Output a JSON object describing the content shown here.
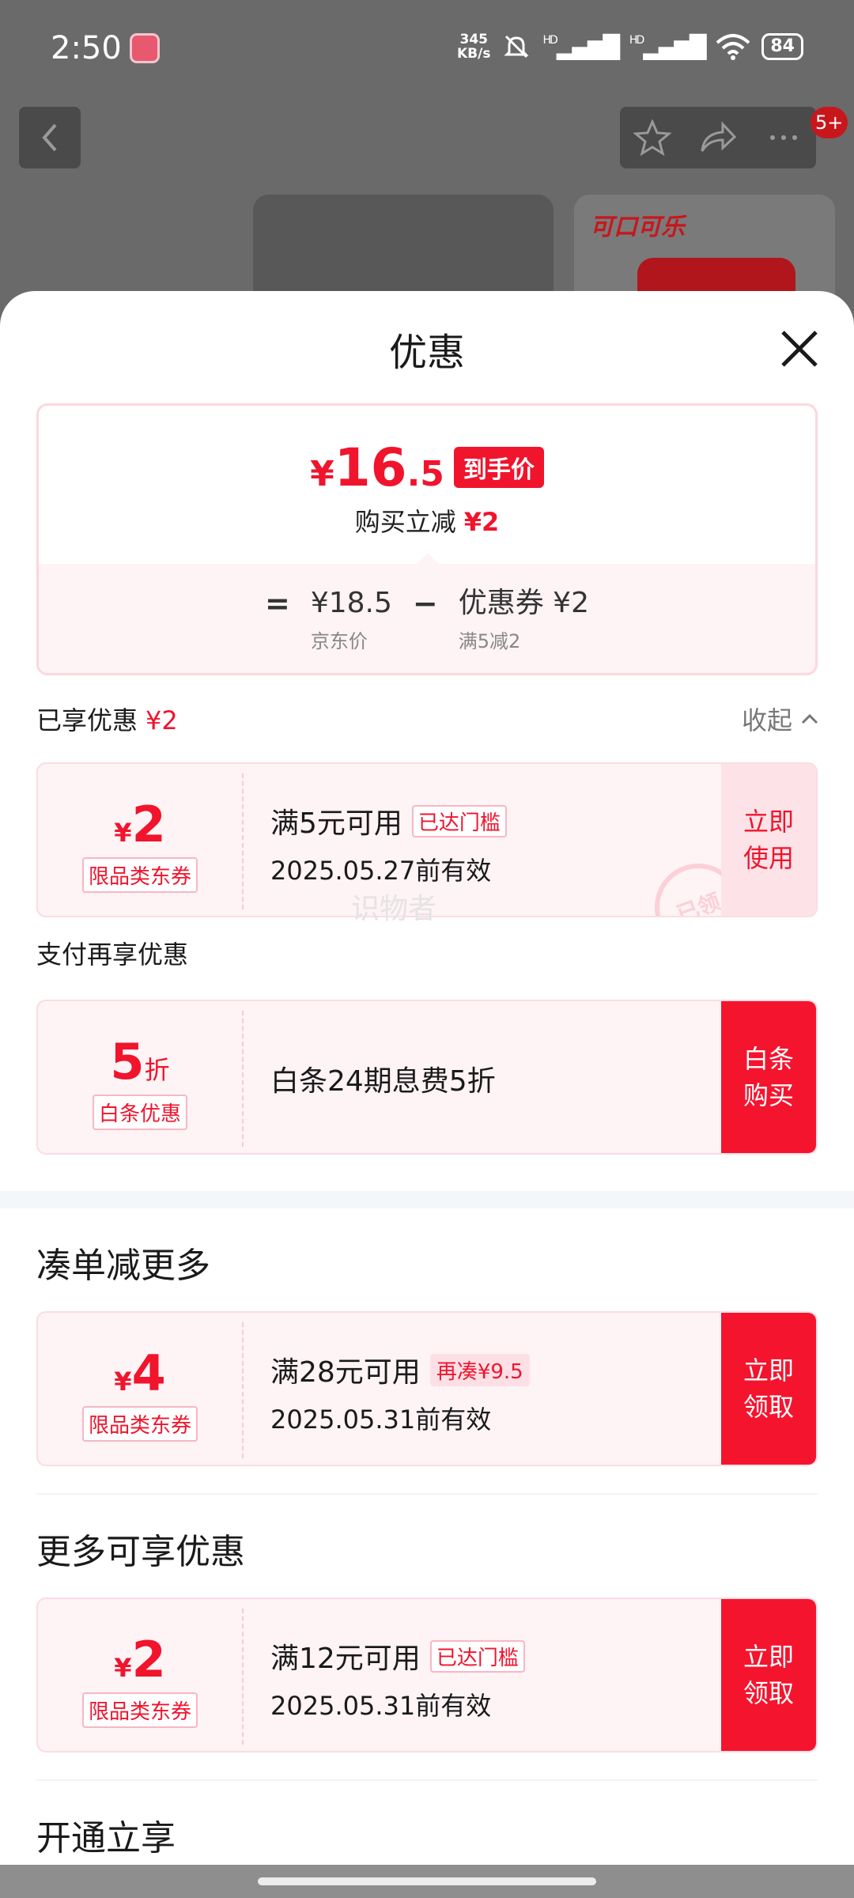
{
  "status_bar": {
    "time": "2:50",
    "net_speed_value": "345",
    "net_speed_unit": "KB/s",
    "signal_1": "HD",
    "signal_2": "HD",
    "battery": "84"
  },
  "background": {
    "notification_badge": "5+",
    "product_logo": "可口可乐"
  },
  "sheet": {
    "title": "优惠",
    "summary": {
      "final_symbol": "¥",
      "final_int": "16",
      "final_dec": ".5",
      "final_tag": "到手价",
      "reduce_label": "购买立减",
      "reduce_value": "¥2",
      "eq": "=",
      "base_price": "¥18.5",
      "base_label": "京东价",
      "minus": "−",
      "coupon_label": "优惠券 ¥2",
      "coupon_rule": "满5减2"
    },
    "enjoyed": {
      "label": "已享优惠",
      "value": "¥2",
      "collapse": "收起"
    },
    "coupon_used": {
      "symbol": "¥",
      "amount": "2",
      "type": "限品类东券",
      "title": "满5元可用",
      "tag": "已达门槛",
      "date": "2025.05.27前有效",
      "action_1": "立即",
      "action_2": "使用",
      "stamp": "已领"
    },
    "watermark": "识物者",
    "pay_more_label": "支付再享优惠",
    "baitiao": {
      "amount": "5",
      "unit": "折",
      "type": "白条优惠",
      "title": "白条24期息费5折",
      "action_1": "白条",
      "action_2": "购买"
    },
    "section_more_order": "凑单减更多",
    "coupon_order": {
      "symbol": "¥",
      "amount": "4",
      "type": "限品类东券",
      "title": "满28元可用",
      "tag": "再凑¥9.5",
      "date": "2025.05.31前有效",
      "action_1": "立即",
      "action_2": "领取"
    },
    "section_more": "更多可享优惠",
    "coupon_more": {
      "symbol": "¥",
      "amount": "2",
      "type": "限品类东券",
      "title": "满12元可用",
      "tag": "已达门槛",
      "date": "2025.05.31前有效",
      "action_1": "立即",
      "action_2": "领取"
    },
    "section_open": "开通立享"
  },
  "colors": {
    "accent_red": "#f0142d",
    "coupon_bg": "#fef3f5"
  }
}
